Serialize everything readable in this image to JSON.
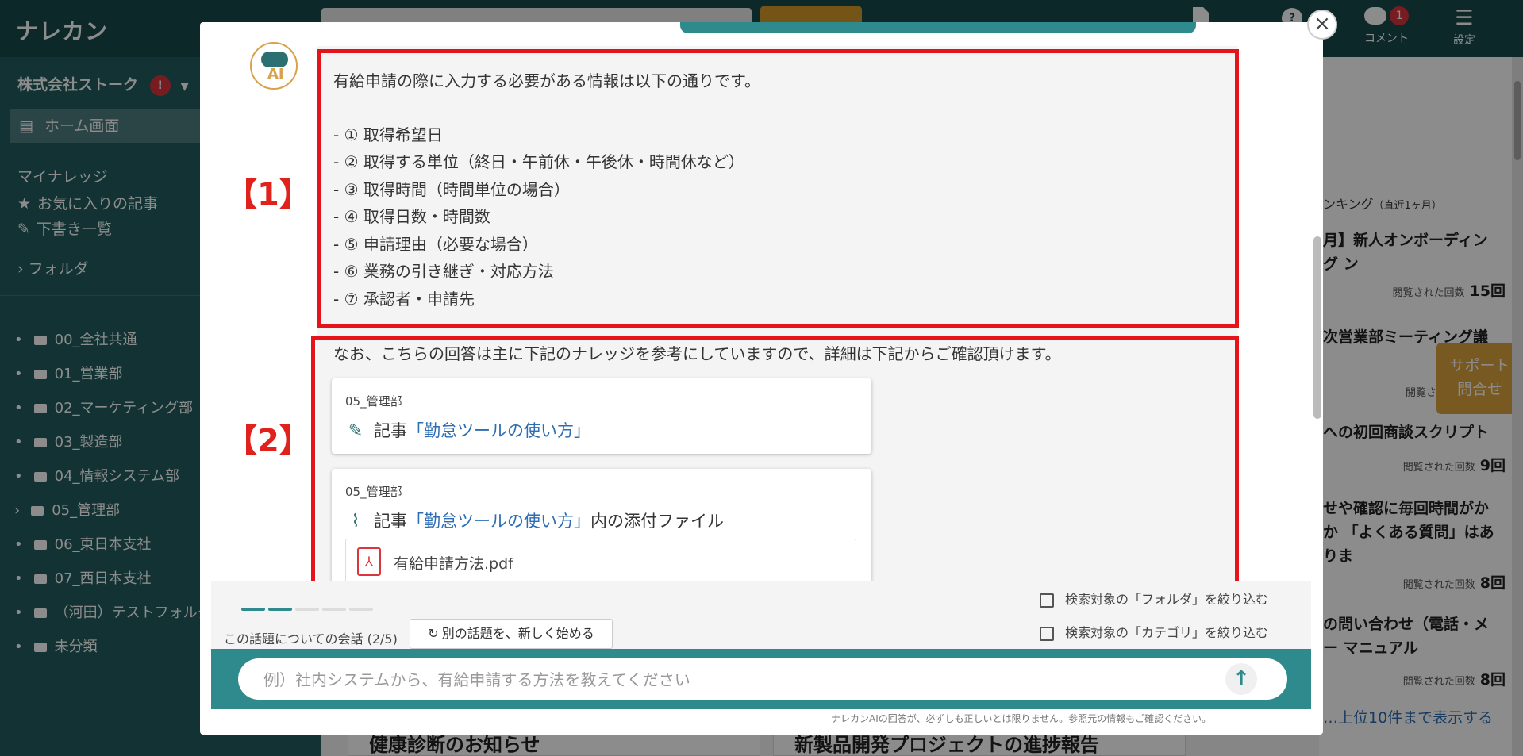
{
  "app": {
    "logo": "ナレカン"
  },
  "header": {
    "comment_label": "コメント",
    "comment_badge": "1",
    "settings_label": "設定"
  },
  "sidebar": {
    "company": "株式会社ストーク",
    "company_badge": "!",
    "home": "ホーム画面",
    "my_knowledge": "マイナレッジ",
    "favorites": "お気に入りの記事",
    "drafts": "下書き一覧",
    "folder_header": "フォルダ",
    "folders": [
      "00_全社共通",
      "01_営業部",
      "02_マーケティング部",
      "03_製造部",
      "04_情報システム部",
      "05_管理部",
      "06_東日本支社",
      "07_西日本支社",
      "（河田）テストフォルダ",
      "未分類"
    ]
  },
  "ranking": {
    "title": "ンキング",
    "period": "（直近1ヶ月）",
    "items": [
      {
        "title": "月】新人オンボーディング ン",
        "count_label": "閲覧された回数",
        "count": "15回"
      },
      {
        "title": "次営業部ミーティング議",
        "count_label": "閲覧された",
        "count": ""
      },
      {
        "title": "への初回商談スクリプト",
        "count_label": "閲覧された回数",
        "count": "9回"
      },
      {
        "title": "せや確認に毎回時間がかか 「よくある質問」はありま",
        "count_label": "閲覧された回数",
        "count": "8回"
      },
      {
        "title": "の問い合わせ（電話・メー マニュアル",
        "count_label": "閲覧された回数",
        "count": "8回"
      }
    ],
    "more": "…上位10件まで表示する"
  },
  "support": {
    "line1": "サポート",
    "line2": "問合せ"
  },
  "bottom_cards": [
    "健康診断のお知らせ",
    "新製品開発プロジェクトの進捗報告"
  ],
  "modal": {
    "close": "×",
    "avatar_label": "AI",
    "marker1": "【1】",
    "marker2": "【2】",
    "answer_intro": "有給申請の際に入力する必要がある情報は以下の通りです。",
    "answer_items": [
      "- ① 取得希望日",
      "- ② 取得する単位（終日・午前休・午後休・時間休など）",
      "- ③ 取得時間（時間単位の場合）",
      "- ④ 取得日数・時間数",
      "- ⑤ 申請理由（必要な場合）",
      "- ⑥ 業務の引き継ぎ・対応方法",
      "- ⑦ 承認者・申請先"
    ],
    "ref_note": "なお、こちらの回答は主に下記のナレッジを参考にしていますので、詳細は下記からご確認頂けます。",
    "ref1": {
      "folder": "05_管理部",
      "prefix": "記事",
      "link": "「勤怠ツールの使い方」"
    },
    "ref2": {
      "folder": "05_管理部",
      "prefix": "記事",
      "link": "「勤怠ツールの使い方」",
      "suffix": "内の添付ファイル",
      "file": "有給申請方法.pdf"
    },
    "conversation": "この話題についての会話 (2/5)",
    "conversation_progress": 0.4,
    "restart": "別の話題を、新しく始める",
    "filter_folder": "検索対象の「フォルダ」を絞り込む",
    "filter_category": "検索対象の「カテゴリ」を絞り込む",
    "input_placeholder": "例）社内システムから、有給申請する方法を教えてください",
    "disclaimer": "ナレカンAIの回答が、必ずしも正しいとは限りません。参照元の情報もご確認ください。"
  },
  "colors": {
    "teal": "#2f8a8d",
    "dark_teal": "#16494b",
    "sidebar": "#215b5d",
    "highlight_red": "#e6131a",
    "link_blue": "#2c6db3",
    "accent_orange": "#d9a33d"
  }
}
